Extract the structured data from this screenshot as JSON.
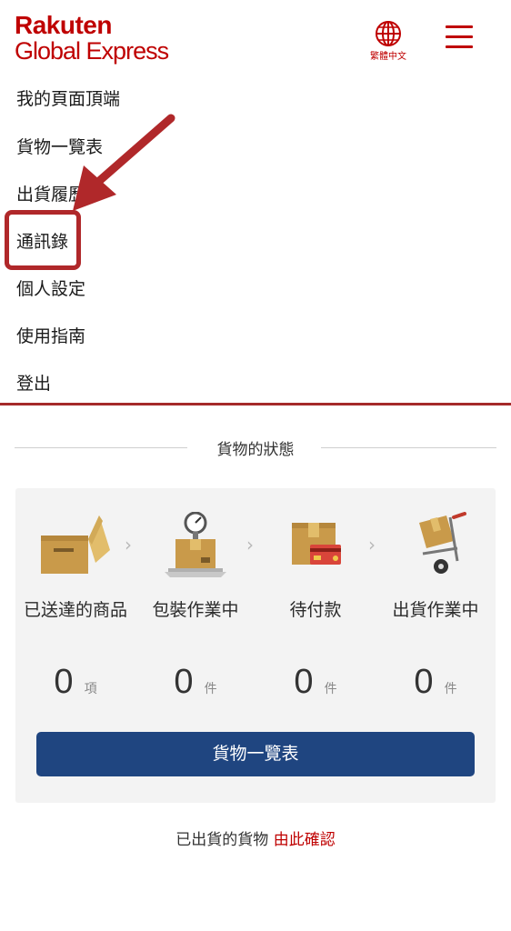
{
  "header": {
    "logo_line1": "Rakuten",
    "logo_line2": "Global Express",
    "language_label": "繁體中文",
    "brand_color": "#bf0000"
  },
  "nav": {
    "items": [
      {
        "label": "我的頁面頂端"
      },
      {
        "label": "貨物一覽表"
      },
      {
        "label": "出貨履歷"
      },
      {
        "label": "通訊錄",
        "highlighted": true
      },
      {
        "label": "個人設定"
      },
      {
        "label": "使用指南"
      },
      {
        "label": "登出"
      }
    ]
  },
  "status": {
    "title": "貨物的狀態",
    "steps": [
      {
        "label": "已送達的商品",
        "count": "0",
        "unit": "項",
        "icon": "open-box-icon"
      },
      {
        "label": "包裝作業中",
        "count": "0",
        "unit": "件",
        "icon": "weighing-scale-box-icon"
      },
      {
        "label": "待付款",
        "count": "0",
        "unit": "件",
        "icon": "box-credit-card-icon"
      },
      {
        "label": "出貨作業中",
        "count": "0",
        "unit": "件",
        "icon": "hand-truck-box-icon"
      }
    ],
    "button_label": "貨物一覽表",
    "button_color": "#1f4580"
  },
  "footer": {
    "text": "已出貨的貨物",
    "link": "由此確認"
  }
}
